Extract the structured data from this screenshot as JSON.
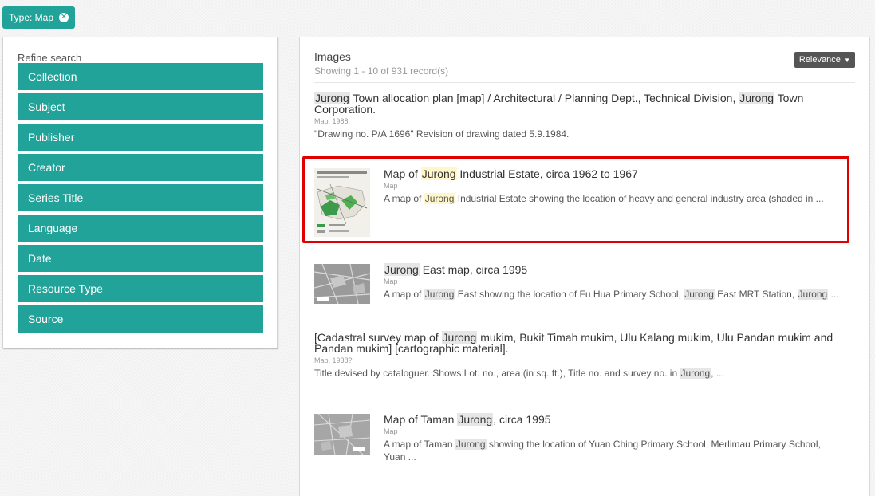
{
  "filter_tag": {
    "label": "Type: Map",
    "remove_icon": "x-circle-icon"
  },
  "sidebar": {
    "refine_label": "Refine search",
    "facets": [
      "Collection",
      "Subject",
      "Publisher",
      "Creator",
      "Series Title",
      "Language",
      "Date",
      "Resource Type",
      "Source"
    ]
  },
  "results": {
    "heading": "Images",
    "count_text": "Showing 1 - 10 of 931 record(s)",
    "sort_label": "Relevance",
    "records": [
      {
        "title_line1_a": "Jurong",
        "title_line1_b": " Town allocation plan [map] / Architectural / Planning Dept., Technical Division, ",
        "title_line1_c": "Jurong",
        "title_line1_d": " Town",
        "title_line2": "Corporation.",
        "meta": "Map, 1988.",
        "desc": "\"Drawing no. P/A 1696\" Revision of drawing dated 5.9.1984."
      },
      {
        "title_a": "Map of ",
        "title_b": "Jurong",
        "title_c": " Industrial Estate, circa 1962 to 1967",
        "meta": "Map",
        "desc_a": "A map of ",
        "desc_b": "Jurong",
        "desc_c": " Industrial Estate showing the location of heavy and general industry area (shaded in ..."
      },
      {
        "title_a": "Jurong",
        "title_b": " East map, circa 1995",
        "meta": "Map",
        "desc_a": "A map of ",
        "desc_b": "Jurong",
        "desc_c": " East showing the location of Fu Hua Primary School, ",
        "desc_d": "Jurong",
        "desc_e": " East MRT Station, ",
        "desc_f": "Jurong",
        "desc_g": " ..."
      },
      {
        "title_line1_a": "[Cadastral survey map of ",
        "title_line1_b": "Jurong",
        "title_line1_c": " mukim, Bukit Timah mukim, Ulu Kalang mukim, Ulu Pandan mukim and",
        "title_line2": "Pandan mukim] [cartographic material].",
        "meta": "Map, 1938?",
        "desc_a": "Title devised by cataloguer. Shows Lot. no., area (in sq. ft.), Title no. and survey no. in ",
        "desc_b": "Jurong",
        "desc_c": ", ..."
      },
      {
        "title_a": "Map of Taman ",
        "title_b": "Jurong",
        "title_c": ", circa 1995",
        "meta": "Map",
        "desc_a": "A map of Taman ",
        "desc_b": "Jurong",
        "desc_c": " showing the location of Yuan Ching Primary School, Merlimau Primary School,",
        "desc_line2": "Yuan ..."
      }
    ]
  },
  "colors": {
    "accent": "#22a39a",
    "sort_button": "#555555",
    "highlight_box": "#e00000",
    "term_highlight": "#fff7c9"
  }
}
